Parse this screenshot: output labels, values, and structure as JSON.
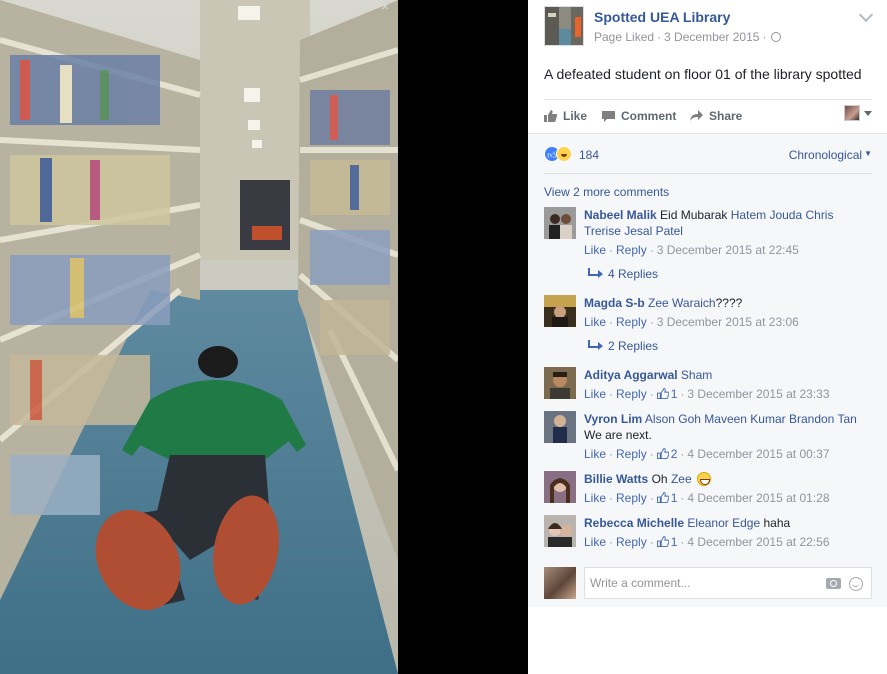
{
  "post": {
    "page_name": "Spotted UEA Library",
    "liked_status": "Page Liked",
    "date": "3 December 2015",
    "separator": "·",
    "text": "A defeated student on floor 01 of the library spotted",
    "photo_description_icon": "photo-student-lying-in-library-aisle"
  },
  "actions": {
    "like": "Like",
    "comment": "Comment",
    "share": "Share"
  },
  "reactions": {
    "count": "184",
    "order": "Chronological"
  },
  "comments_section": {
    "view_more": "View 2 more comments",
    "comments": [
      {
        "name": "Nabeel Malik",
        "text": "Eid Mubarak",
        "tags": "Hatem Jouda Chris Trerise Jesal Patel",
        "like": "Like",
        "reply": "Reply",
        "time": "3 December 2015 at 22:45",
        "replies": "4 Replies"
      },
      {
        "name": "Magda S-b",
        "tags": "Zee Waraich",
        "text": "????",
        "like": "Like",
        "reply": "Reply",
        "time": "3 December 2015 at 23:06",
        "replies": "2 Replies"
      },
      {
        "name": "Aditya Aggarwal",
        "tags": "Sham",
        "like": "Like",
        "reply": "Reply",
        "likes": "1",
        "time": "3 December 2015 at 23:33"
      },
      {
        "name": "Vyron Lim",
        "tags": "Alson Goh Maveen Kumar Brandon Tan",
        "text": "We are next.",
        "like": "Like",
        "reply": "Reply",
        "likes": "2",
        "time": "4 December 2015 at 00:37"
      },
      {
        "name": "Billie Watts",
        "text": "Oh",
        "tags": "Zee",
        "like": "Like",
        "reply": "Reply",
        "likes": "1",
        "time": "4 December 2015 at 01:28"
      },
      {
        "name": "Rebecca Michelle",
        "tags": "Eleanor Edge",
        "text": "haha",
        "like": "Like",
        "reply": "Reply",
        "likes": "1",
        "time": "4 December 2015 at 22:56"
      }
    ]
  },
  "composer": {
    "placeholder": "Write a comment..."
  },
  "colors": {
    "link_blue": "#365899",
    "meta_gray": "#90949c",
    "panel_bg": "#f6f7f9",
    "like_blue": "#4080ff"
  }
}
